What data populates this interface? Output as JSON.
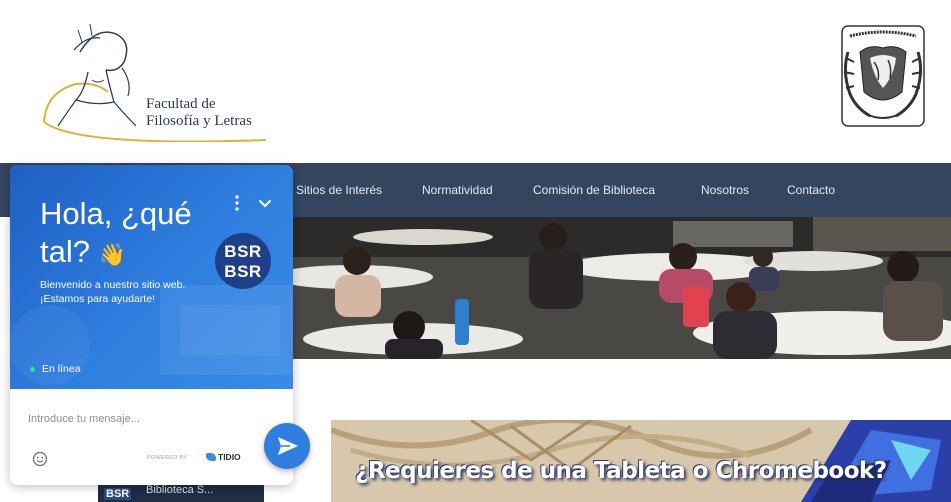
{
  "header": {
    "faculty_line1": "Facultad de",
    "faculty_line2": "Filosofía y Letras",
    "faculty_logo_icon": "athena-helmet-logo-icon",
    "university_logo_icon": "unam-seal-icon"
  },
  "nav": {
    "items": [
      "Sitios de Interés",
      "Normatividad",
      "Comisión de Biblioteca",
      "Nosotros",
      "Contacto"
    ],
    "background": "#34455d"
  },
  "banner": {
    "text": "¿Requieres de una Tableta o Chromebook?"
  },
  "thumbnail": {
    "logo_text": "BSR",
    "caption": "Biblioteca S..."
  },
  "chat": {
    "title_line1": "Hola, ¿qué",
    "title_line2": "tal?",
    "wave_emoji": "👋",
    "subtitle": "Bienvenido a nuestro sitio web. ¡Estamos para ayudarte!",
    "avatar_line1": "BSR",
    "avatar_line2": "BSR",
    "status": "En línea",
    "input_placeholder": "Introduce tu mensaje...",
    "powered_by": "POWERED BY",
    "brand": "TIDIO",
    "accent": "#2f7fe0",
    "status_color": "#2ee87a"
  }
}
